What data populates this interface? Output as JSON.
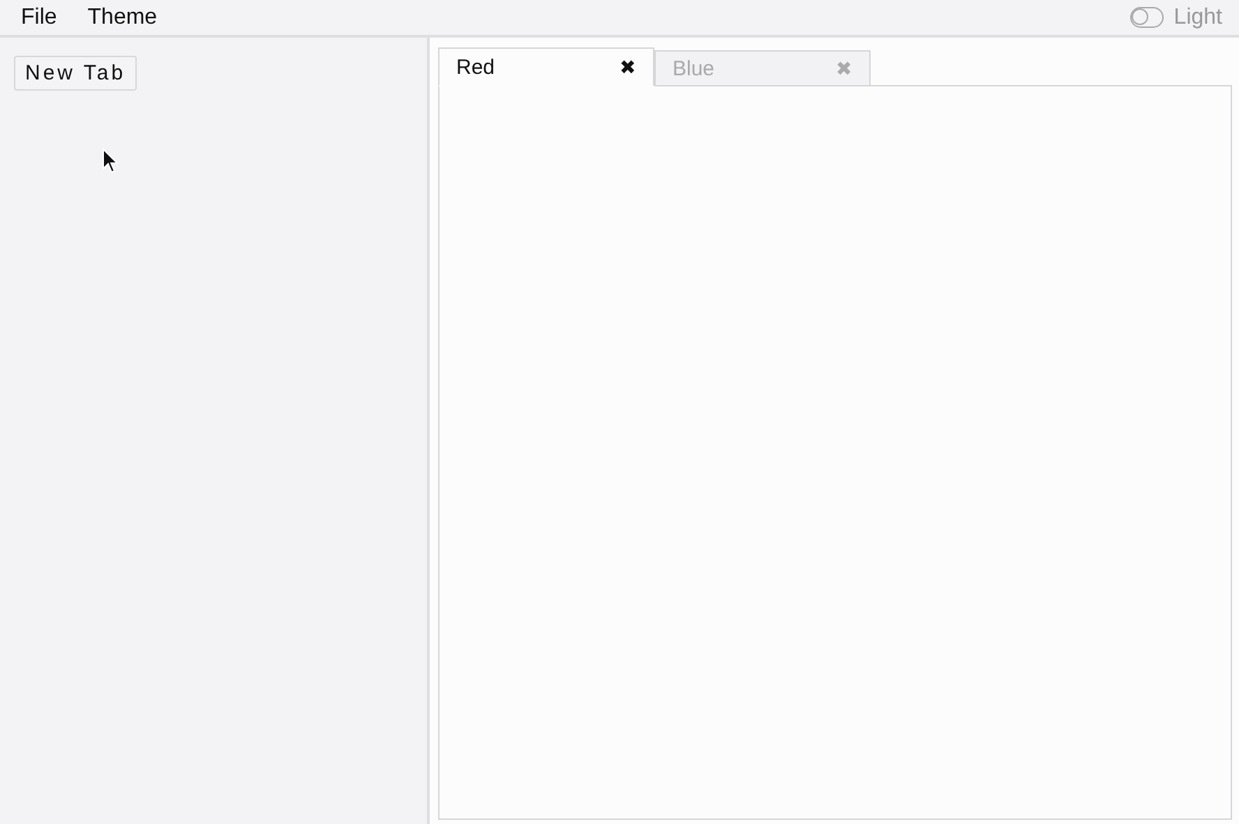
{
  "menu": [
    "File",
    "Theme"
  ],
  "theme_toggle": {
    "on": false,
    "label": "Light"
  },
  "sidebar": {
    "button": "New Tab"
  },
  "tabs": [
    {
      "label": "Red",
      "close": "✖",
      "selected": true
    },
    {
      "label": "Blue",
      "close": "✖",
      "selected": false
    }
  ]
}
